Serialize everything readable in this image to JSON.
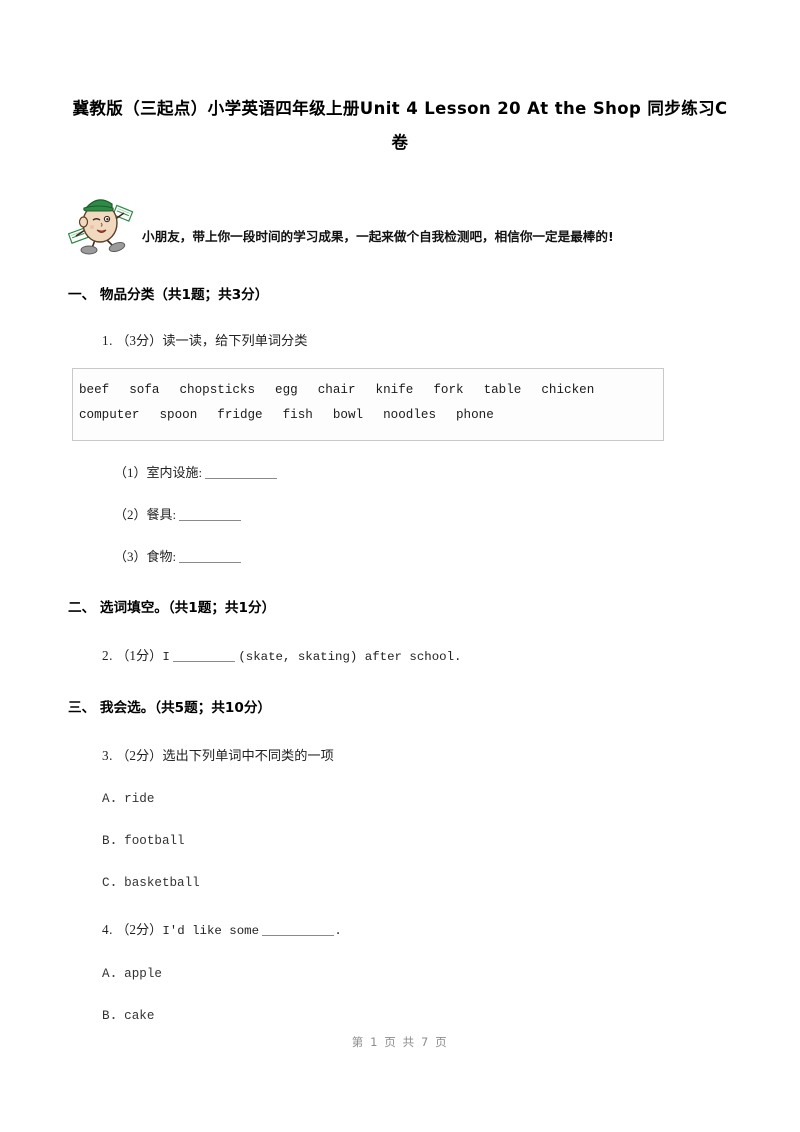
{
  "document": {
    "title": "冀教版（三起点）小学英语四年级上册Unit 4 Lesson 20 At the Shop 同步练习C卷",
    "intro_text": "小朋友，带上你一段时间的学习成果，一起来做个自我检测吧，相信你一定是最棒的!",
    "mascot_icon": "cartoon-student-mascot-icon",
    "footer": "第 1 页 共 7 页"
  },
  "sections": [
    {
      "heading": "一、  物品分类（共1题；共3分）",
      "questions": [
        {
          "number": "1.",
          "score": "（3分）",
          "stem": "读一读，给下列单词分类",
          "wordbank": [
            "beef",
            "sofa",
            "chopsticks",
            "egg",
            "chair",
            "knife",
            "fork",
            "table",
            "chicken",
            "computer",
            "spoon",
            "fridge",
            "fish",
            "bowl",
            "noodles",
            "phone"
          ],
          "subitems": [
            {
              "label": "（1）室内设施:"
            },
            {
              "label": "（2）餐具:"
            },
            {
              "label": "（3）食物:"
            }
          ]
        }
      ]
    },
    {
      "heading": "二、  选词填空。（共1题；共1分）",
      "questions": [
        {
          "number": "2.",
          "score": "（1分）",
          "stem_before": "I",
          "stem_after": "(skate, skating) after school."
        }
      ]
    },
    {
      "heading": "三、  我会选。（共5题；共10分）",
      "questions": [
        {
          "number": "3.",
          "score": "（2分）",
          "stem": "选出下列单词中不同类的一项",
          "options": [
            {
              "letter": "A．",
              "text": "ride"
            },
            {
              "letter": "B．",
              "text": "football"
            },
            {
              "letter": "C．",
              "text": "basketball"
            }
          ]
        },
        {
          "number": "4.",
          "score": "（2分）",
          "stem_before": "I'd like some",
          "stem_after": ".",
          "options": [
            {
              "letter": "A．",
              "text": "apple"
            },
            {
              "letter": "B．",
              "text": "cake"
            }
          ]
        }
      ]
    }
  ],
  "colors": {
    "text": "#000000",
    "body_text": "#222222",
    "footer": "#8d8d8d",
    "box_border": "#c9c9c9",
    "blank_line": "#8a8a8a",
    "mascot_hat": "#2e8b46",
    "mascot_face": "#f0d9bf",
    "mascot_shoe": "#9b9b9b"
  }
}
